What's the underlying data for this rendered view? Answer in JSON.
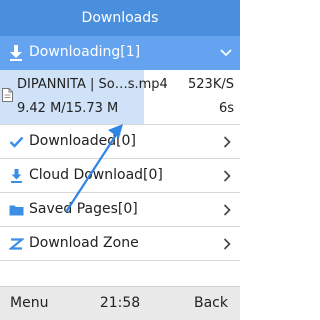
{
  "title": "Downloads",
  "colors": {
    "title_bar": "#4a8ede",
    "section_header": "#63a3ef",
    "progress_fill": "#cfe2f7",
    "icon_blue": "#3d8fe6",
    "softkey_bar": "#e9e9e9"
  },
  "downloading": {
    "label": "Downloading[1]",
    "icon": "download-arrow-icon",
    "expanded": true,
    "items": [
      {
        "name": "DIPANNITA | So…s.mp4",
        "speed": "523K/S",
        "size": "9.42 M/15.73 M",
        "remaining": "6s",
        "progress": 0.6,
        "icon": "file-icon"
      }
    ]
  },
  "menu": [
    {
      "label": "Downloaded[0]",
      "icon": "check-icon"
    },
    {
      "label": "Cloud Download[0]",
      "icon": "cloud-download-icon"
    },
    {
      "label": "Saved Pages[0]",
      "icon": "folder-icon"
    },
    {
      "label": "Download Zone",
      "icon": "z-icon"
    }
  ],
  "softkeys": {
    "left": "Menu",
    "clock": "21:58",
    "right": "Back"
  }
}
